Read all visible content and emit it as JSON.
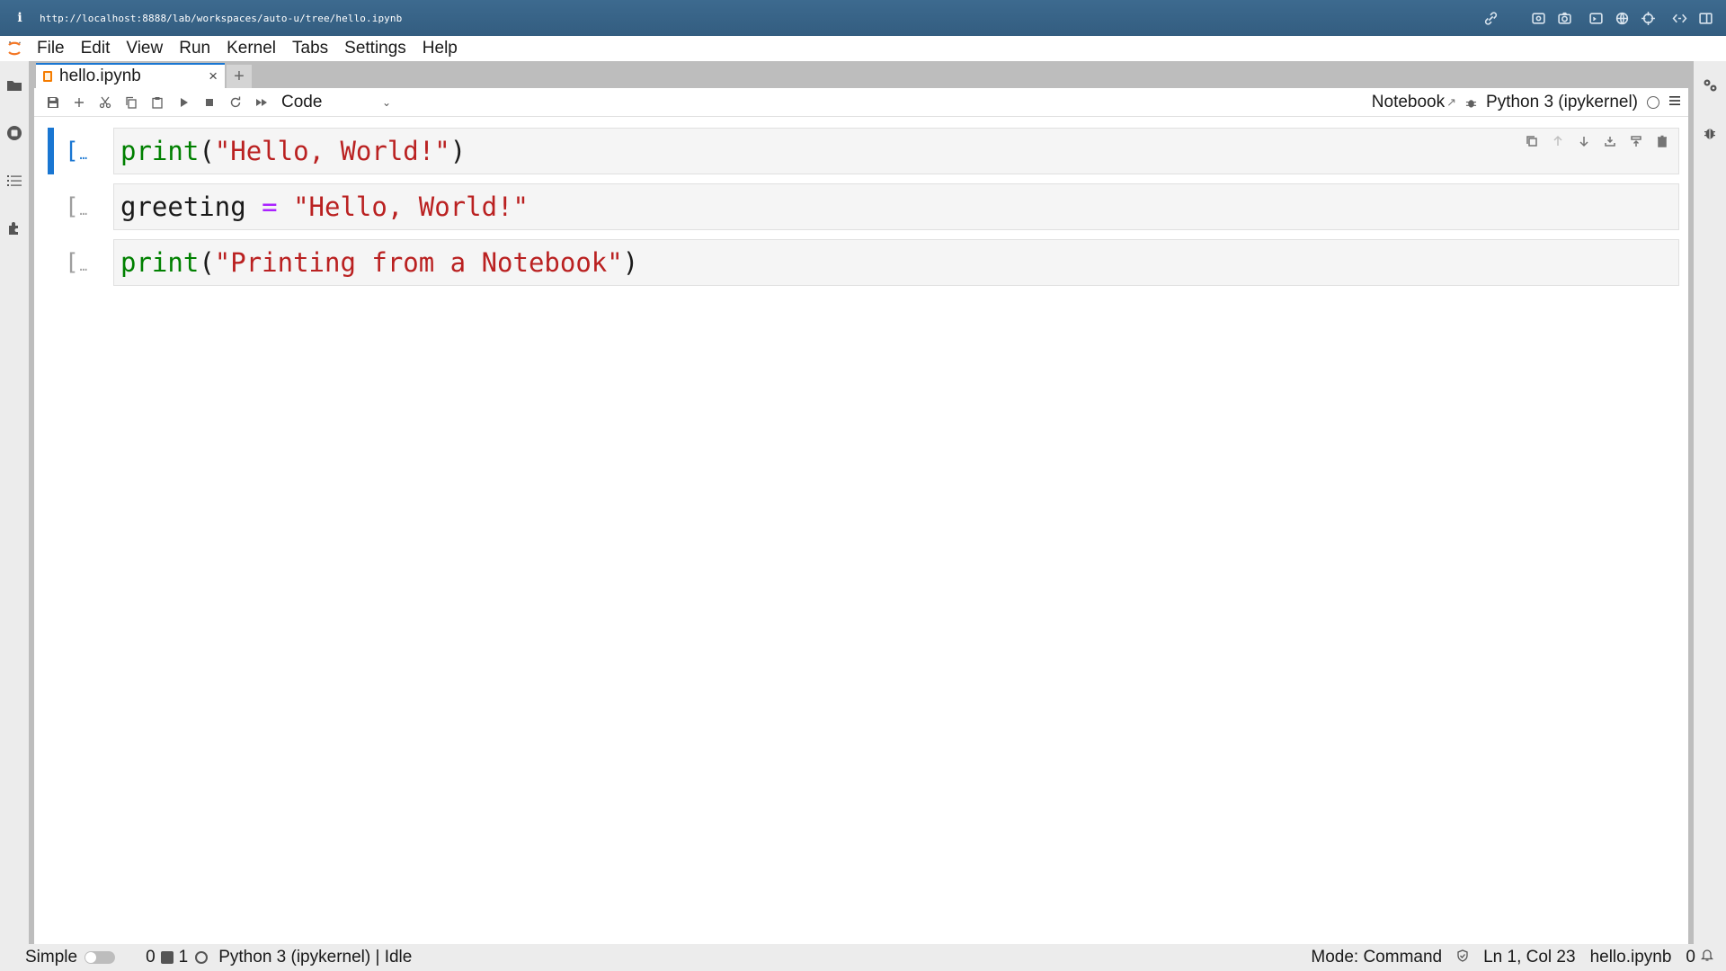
{
  "browser": {
    "info_icon": "i",
    "url": "http://localhost:8888/lab/workspaces/auto-u/tree/hello.ipynb",
    "icons": [
      "link-icon",
      "screenshot-icon",
      "camera-icon",
      "terminal-icon",
      "globe-icon",
      "crosshair-icon",
      "code-icon",
      "split-view-icon"
    ]
  },
  "menu": {
    "items": [
      "File",
      "Edit",
      "View",
      "Run",
      "Kernel",
      "Tabs",
      "Settings",
      "Help"
    ]
  },
  "tabs": {
    "active_title": "hello.ipynb",
    "close": "×",
    "add": "+"
  },
  "toolbar": {
    "cell_type": "Code",
    "notebook_label": "Notebook",
    "kernel_name": "Python 3 (ipykernel)"
  },
  "cells": [
    {
      "prompt": "[",
      "dots": "…",
      "active": true
    },
    {
      "prompt": "[",
      "dots": "…",
      "active": false
    },
    {
      "prompt": "[",
      "dots": "…",
      "active": false
    }
  ],
  "code": {
    "cell1": {
      "fn": "print",
      "open": "(",
      "str": "\"Hello, World!\"",
      "close": ")"
    },
    "cell2": {
      "var": "greeting ",
      "op": "=",
      "str": " \"Hello, World!\""
    },
    "cell3": {
      "fn": "print",
      "open": "(",
      "str": "\"Printing from a Notebook\"",
      "close": ")"
    }
  },
  "status": {
    "mode_label": "Simple",
    "terminals": "0",
    "kernels": "1",
    "kernel_status": "Python 3 (ipykernel) | Idle",
    "mode": "Mode: Command",
    "cursor": "Ln 1, Col 23",
    "file": "hello.ipynb",
    "notifications": "0"
  },
  "colors": {
    "accent": "#1976d2",
    "browser_bar": "#3d6a8f",
    "keyword": "#008000",
    "string": "#ba2121",
    "operator": "#aa22ff"
  }
}
